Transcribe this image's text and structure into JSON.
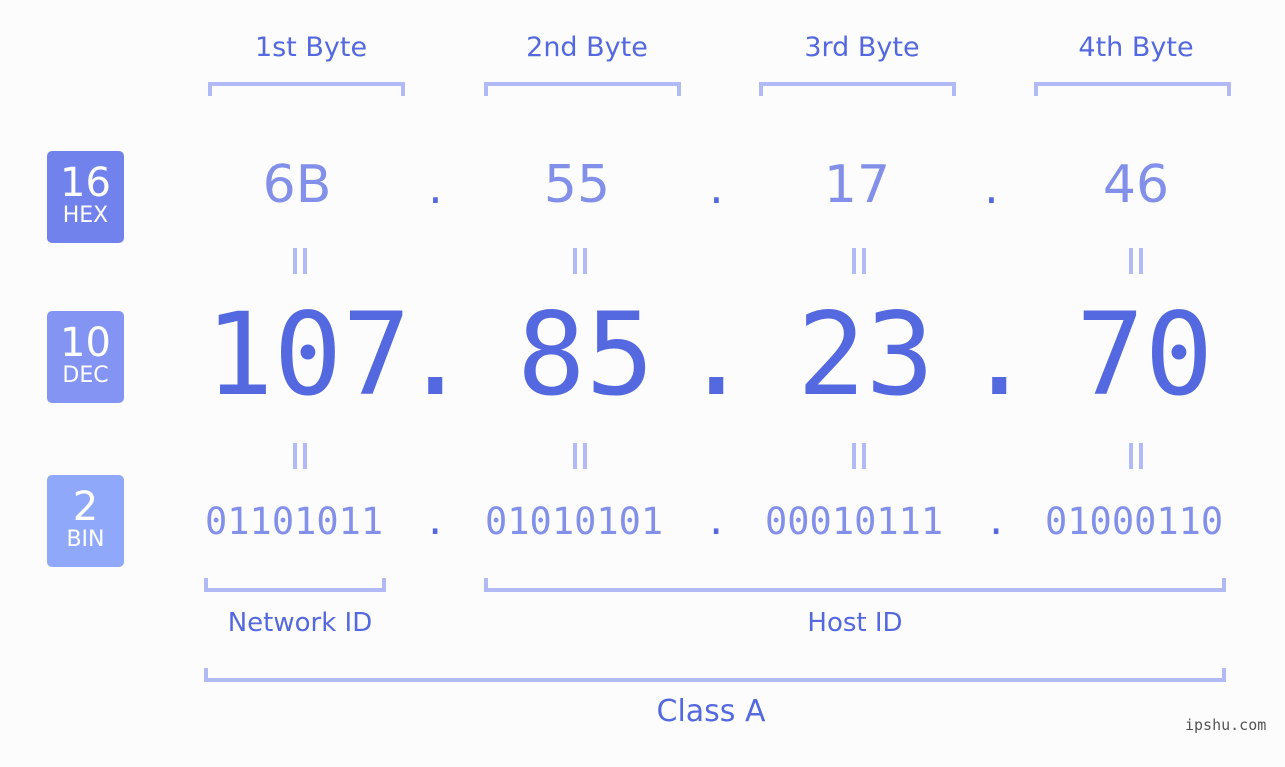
{
  "bases": [
    {
      "num": "16",
      "label": "HEX",
      "color": "#7182ec"
    },
    {
      "num": "10",
      "label": "DEC",
      "color": "#8394f2"
    },
    {
      "num": "2",
      "label": "BIN",
      "color": "#8fa8f9"
    }
  ],
  "byte_headers": [
    "1st Byte",
    "2nd Byte",
    "3rd Byte",
    "4th Byte"
  ],
  "hex": [
    "6B",
    "55",
    "17",
    "46"
  ],
  "dec": [
    "107",
    "85",
    "23",
    "70"
  ],
  "bin": [
    "01101011",
    "01010101",
    "00010111",
    "01000110"
  ],
  "separator": ".",
  "labels": {
    "network_id": "Network ID",
    "host_id": "Host ID",
    "class": "Class A"
  },
  "watermark": "ipshu.com",
  "colors": {
    "accent": "#5468e0",
    "light": "#8290ea",
    "bracket": "#b1baf5"
  }
}
